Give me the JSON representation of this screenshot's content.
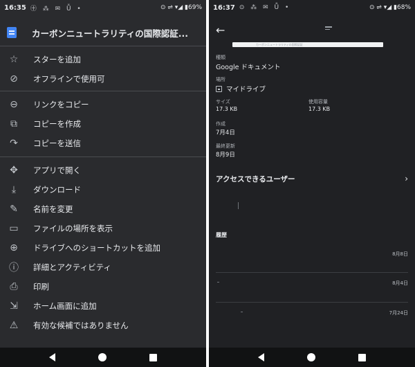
{
  "left": {
    "status": {
      "time": "16:35",
      "notif": "㊉ ⁂ ✉ Ǚ •",
      "system": "⊙ ⇌ ▾◢ ▮69%"
    },
    "header_title": "カーボンニュートラリティの国際認証...",
    "menu": [
      {
        "icon": "star-icon",
        "glyph": "☆",
        "label": "スターを追加"
      },
      {
        "icon": "offline-icon",
        "glyph": "⊘",
        "label": "オフラインで使用可"
      },
      {
        "icon": "link-icon",
        "glyph": "⊖",
        "label": "リンクをコピー"
      },
      {
        "icon": "copy-icon",
        "glyph": "⧉",
        "label": "コピーを作成"
      },
      {
        "icon": "send-icon",
        "glyph": "↷",
        "label": "コピーを送信"
      },
      {
        "icon": "open-with-icon",
        "glyph": "✥",
        "label": "アプリで開く"
      },
      {
        "icon": "download-icon",
        "glyph": "⤓",
        "label": "ダウンロード"
      },
      {
        "icon": "rename-icon",
        "glyph": "✎",
        "label": "名前を変更"
      },
      {
        "icon": "folder-icon",
        "glyph": "▭",
        "label": "ファイルの場所を表示"
      },
      {
        "icon": "drive-shortcut-icon",
        "glyph": "⊕",
        "label": "ドライブへのショートカットを追加"
      },
      {
        "icon": "info-icon",
        "glyph": "ⓘ",
        "label": "詳細とアクティビティ"
      },
      {
        "icon": "print-icon",
        "glyph": "⎙",
        "label": "印刷"
      },
      {
        "icon": "add-to-home-icon",
        "glyph": "⇲",
        "label": "ホーム画面に追加"
      },
      {
        "icon": "feedback-icon",
        "glyph": "⚠",
        "label": "有効な候補ではありません"
      }
    ]
  },
  "right": {
    "status": {
      "time": "16:37",
      "notif": "⊙ ⁂ ✉ Ǚ •",
      "system": "⊙ ⇌ ▾◢ ▮68%"
    },
    "preview_text": "カーボンニュートラリティの国際認証",
    "type_label": "種類",
    "type_value": "Google ドキュメント",
    "location_label": "場所",
    "location_value": "マイドライブ",
    "size_label": "サイズ",
    "size_value": "17.3 KB",
    "storage_label": "使用容量",
    "storage_value": "17.3 KB",
    "created_label": "作成",
    "created_value": "7月4日",
    "modified_label": "最終更新",
    "modified_value": "8月9日",
    "access_label": "アクセスできるユーザー",
    "history_title": "履歴",
    "history_dates": [
      "8月8日",
      "8月4日",
      "7月24日"
    ]
  }
}
